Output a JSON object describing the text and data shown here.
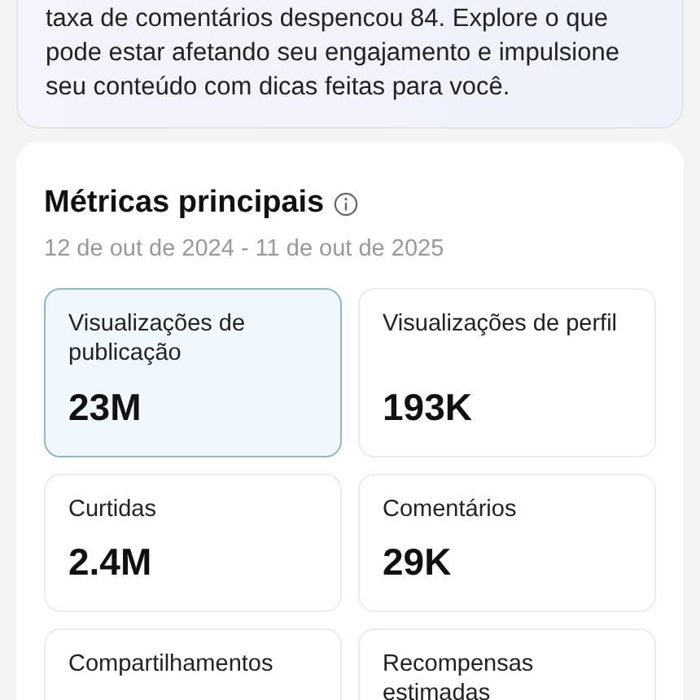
{
  "banner": {
    "text": "taxa de comentários despencou 84. Explore o que pode estar afetando seu engajamento e impulsione seu conteúdo com dicas feitas para você."
  },
  "metrics": {
    "title": "Métricas principais",
    "date_range": "12 de out de 2024 - 11 de out de 2025",
    "tiles": [
      {
        "label": "Visualizações de publicação",
        "value": "23M",
        "selected": true
      },
      {
        "label": "Visualizações de perfil",
        "value": "193K",
        "selected": false
      },
      {
        "label": "Curtidas",
        "value": "2.4M",
        "selected": false
      },
      {
        "label": "Comentários",
        "value": "29K",
        "selected": false
      },
      {
        "label": "Compartilhamentos",
        "selected": false
      },
      {
        "label": "Recompensas estimadas",
        "selected": false
      }
    ]
  }
}
